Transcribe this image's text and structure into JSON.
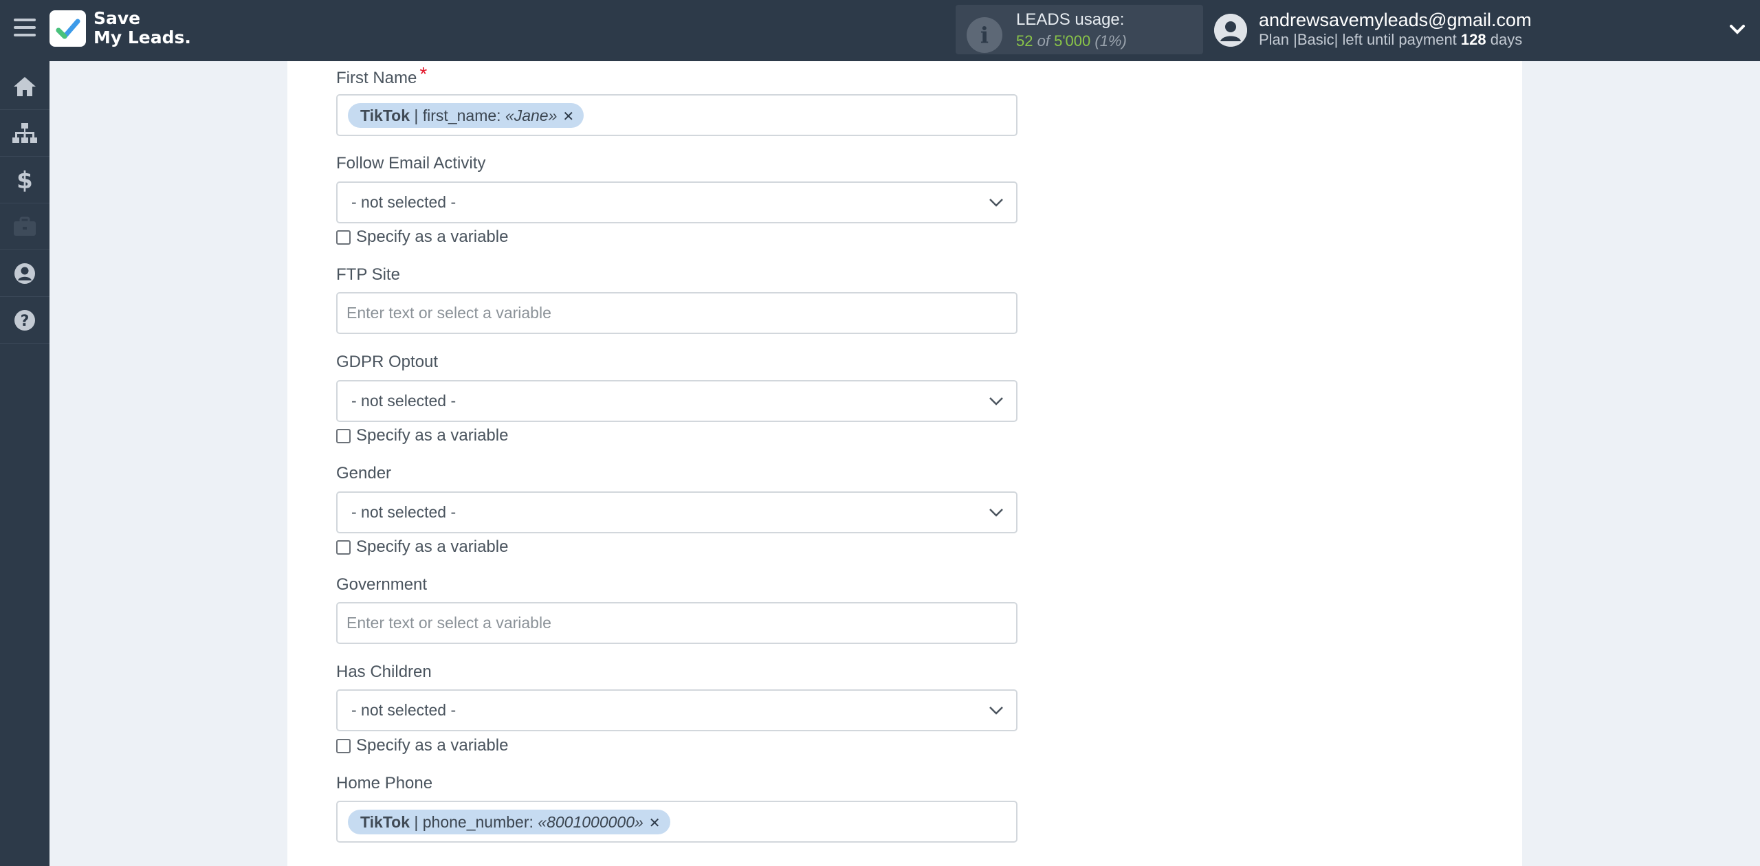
{
  "app": {
    "logo_line1": "Save",
    "logo_line2": "My Leads."
  },
  "usage": {
    "label": "LEADS usage:",
    "used": "52",
    "of": "of",
    "total": "5'000",
    "percent": "(1%)"
  },
  "user": {
    "email": "andrewsavemyleads@gmail.com",
    "plan_text": "Plan |Basic| left until payment",
    "days_count": "128",
    "days_label": "days"
  },
  "sidebar": {
    "items": [
      "home-icon",
      "sitemap-icon",
      "dollar-icon",
      "briefcase-icon",
      "account-icon",
      "help-icon"
    ]
  },
  "form": {
    "first_name": {
      "label": "First Name",
      "required_mark": "*",
      "tag_source": "TikTok",
      "tag_sep": " | ",
      "tag_field": "first_name: ",
      "tag_value": "«Jane»"
    },
    "follow_email_activity": {
      "label": "Follow Email Activity",
      "value": "- not selected -",
      "var_label": "Specify as a variable"
    },
    "ftp_site": {
      "label": "FTP Site",
      "placeholder": "Enter text or select a variable"
    },
    "gdpr_optout": {
      "label": "GDPR Optout",
      "value": "- not selected -",
      "var_label": "Specify as a variable"
    },
    "gender": {
      "label": "Gender",
      "value": "- not selected -",
      "var_label": "Specify as a variable"
    },
    "government": {
      "label": "Government",
      "placeholder": "Enter text or select a variable"
    },
    "has_children": {
      "label": "Has Children",
      "value": "- not selected -",
      "var_label": "Specify as a variable"
    },
    "home_phone": {
      "label": "Home Phone",
      "tag_source": "TikTok",
      "tag_sep": " | ",
      "tag_field": "phone_number: ",
      "tag_value": "«8001000000»"
    }
  },
  "colors": {
    "topbar_bg": "#2d3a49",
    "page_bg": "#edf1f6",
    "accent_green": "#8ac548",
    "tag_bg": "#c6dbf1",
    "required_red": "#e2172b"
  }
}
